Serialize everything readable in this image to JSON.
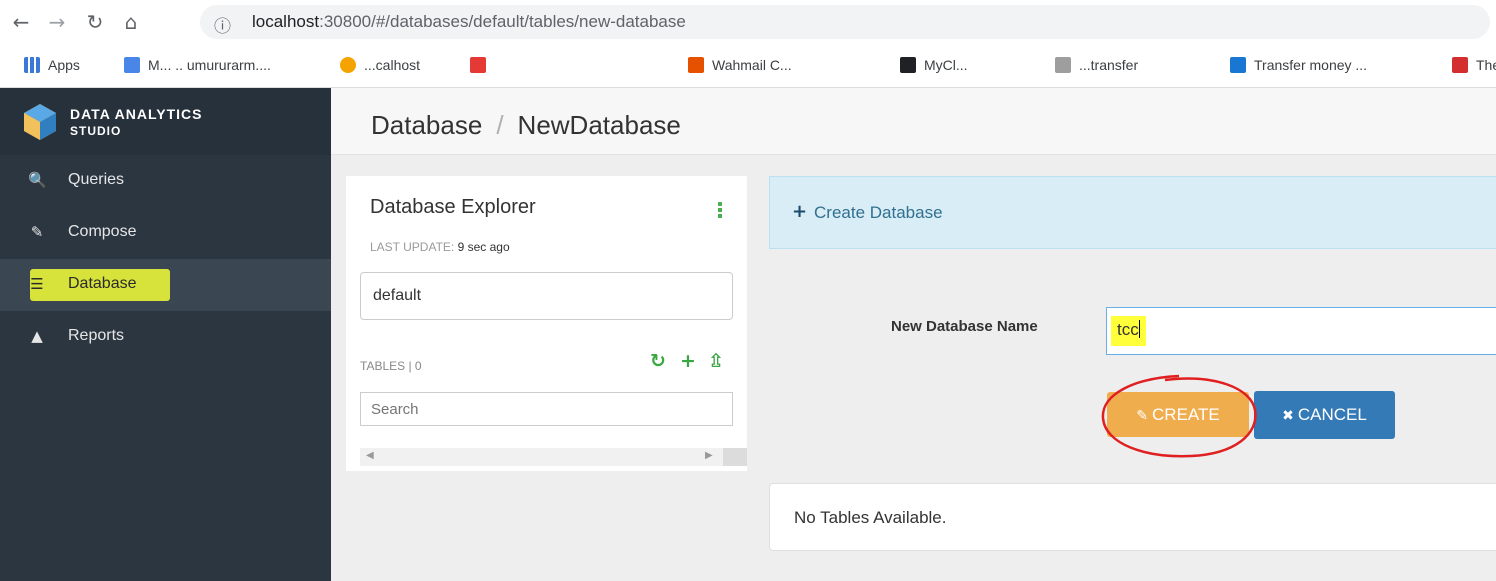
{
  "browser": {
    "url_host": "localhost",
    "url_path": ":30800/#/databases/default/tables/new-database",
    "bookmarks": [
      {
        "label": "Apps",
        "color": "#3c78d8"
      },
      {
        "label": "M...  .. umururarm....",
        "color": "#4a86e8"
      },
      {
        "label": "...calhost",
        "color": "#f4a300"
      },
      {
        "label": "",
        "color": "#e53935"
      },
      {
        "label": "Wahmail C...",
        "color": "#e65100"
      },
      {
        "label": "MyCl...",
        "color": "#202124"
      },
      {
        "label": "...transfer",
        "color": "#9e9e9e"
      },
      {
        "label": "Transfer money ...",
        "color": "#1976d2"
      },
      {
        "label": "The",
        "color": "#d32f2f"
      }
    ]
  },
  "sidebar": {
    "brand_title": "DATA ANALYTICS",
    "brand_sub": "STUDIO",
    "items": [
      {
        "label": "Queries",
        "icon": "search-icon"
      },
      {
        "label": "Compose",
        "icon": "edit-icon"
      },
      {
        "label": "Database",
        "icon": "database-icon",
        "active": true
      },
      {
        "label": "Reports",
        "icon": "chart-icon"
      }
    ]
  },
  "header": {
    "crumb_root": "Database",
    "crumb_sep": "/",
    "crumb_current": "NewDatabase"
  },
  "explorer": {
    "title": "Database Explorer",
    "last_update_label": "LAST UPDATE:",
    "last_update_value": "9 sec ago",
    "selected_db": "default",
    "tables_label": "TABLES  |  0",
    "search_placeholder": "Search"
  },
  "create": {
    "banner_label": "Create Database",
    "name_label": "New Database Name",
    "name_value": "tcc",
    "create_label": "CREATE",
    "cancel_label": "CANCEL",
    "empty_message": "No Tables Available."
  },
  "colors": {
    "sidebar_bg": "#2c3640",
    "create_btn": "#f0ad4e",
    "cancel_btn": "#337ab7",
    "banner_bg": "#d9edf7",
    "highlight": "#ffff3a",
    "accent_green": "#3aa742"
  }
}
